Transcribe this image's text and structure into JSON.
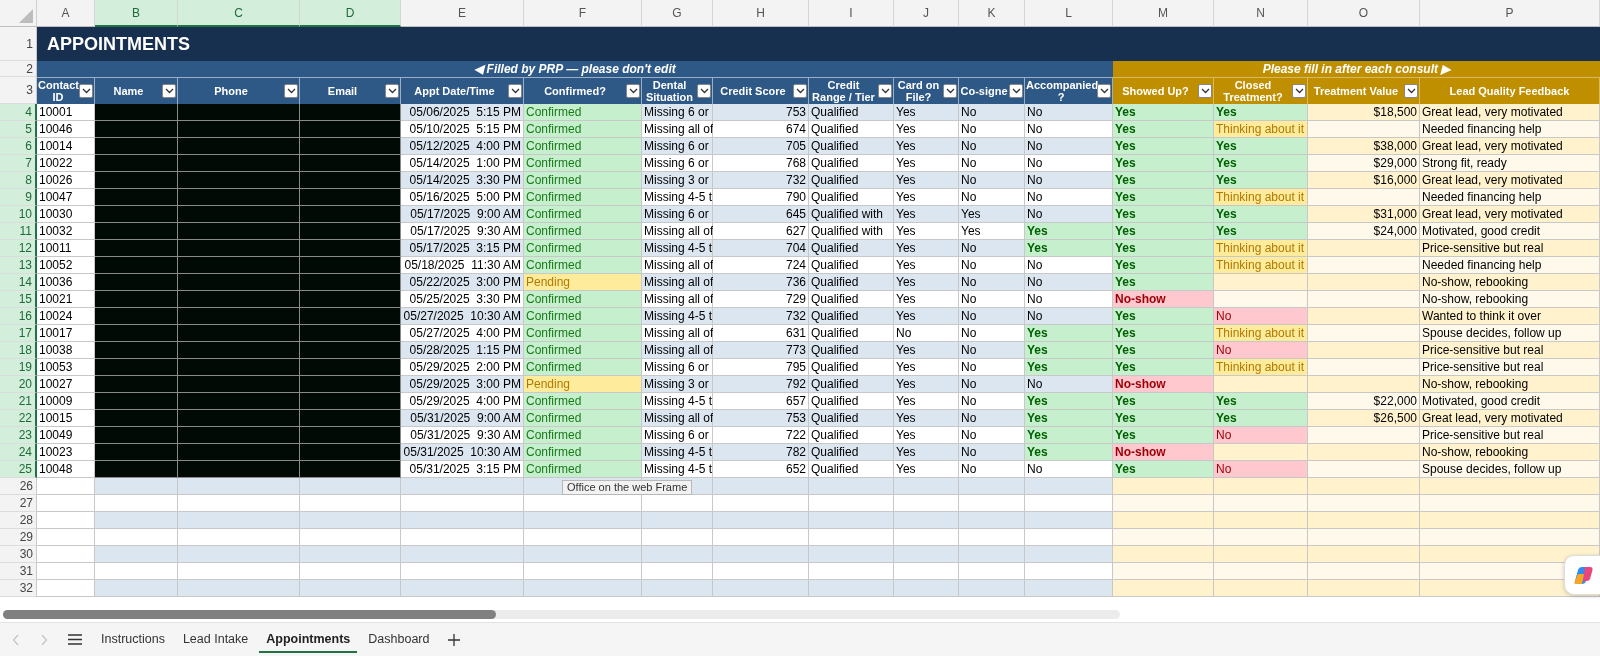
{
  "column_letters": [
    {
      "label": "A",
      "selected": false
    },
    {
      "label": "B",
      "selected": true
    },
    {
      "label": "C",
      "selected": true
    },
    {
      "label": "D",
      "selected": true
    },
    {
      "label": "E",
      "selected": false
    },
    {
      "label": "F",
      "selected": false
    },
    {
      "label": "G",
      "selected": false
    },
    {
      "label": "H",
      "selected": false
    },
    {
      "label": "I",
      "selected": false
    },
    {
      "label": "J",
      "selected": false
    },
    {
      "label": "K",
      "selected": false
    },
    {
      "label": "L",
      "selected": false
    },
    {
      "label": "M",
      "selected": false
    },
    {
      "label": "N",
      "selected": false
    },
    {
      "label": "O",
      "selected": false
    },
    {
      "label": "P",
      "selected": false
    }
  ],
  "row_numbers": [
    {
      "label": "1",
      "selected": false
    },
    {
      "label": "2",
      "selected": false
    },
    {
      "label": "3",
      "selected": false
    },
    {
      "label": "4",
      "selected": true
    },
    {
      "label": "5",
      "selected": true
    },
    {
      "label": "6",
      "selected": true
    },
    {
      "label": "7",
      "selected": true
    },
    {
      "label": "8",
      "selected": true
    },
    {
      "label": "9",
      "selected": true
    },
    {
      "label": "10",
      "selected": true
    },
    {
      "label": "11",
      "selected": true
    },
    {
      "label": "12",
      "selected": true
    },
    {
      "label": "13",
      "selected": true
    },
    {
      "label": "14",
      "selected": true
    },
    {
      "label": "15",
      "selected": true
    },
    {
      "label": "16",
      "selected": true
    },
    {
      "label": "17",
      "selected": true
    },
    {
      "label": "18",
      "selected": true
    },
    {
      "label": "19",
      "selected": true
    },
    {
      "label": "20",
      "selected": true
    },
    {
      "label": "21",
      "selected": true
    },
    {
      "label": "22",
      "selected": true
    },
    {
      "label": "23",
      "selected": true
    },
    {
      "label": "24",
      "selected": true
    },
    {
      "label": "25",
      "selected": true
    },
    {
      "label": "26",
      "selected": false
    },
    {
      "label": "27",
      "selected": false
    },
    {
      "label": "28",
      "selected": false
    },
    {
      "label": "29",
      "selected": false
    },
    {
      "label": "30",
      "selected": false
    },
    {
      "label": "31",
      "selected": false
    },
    {
      "label": "32",
      "selected": false
    }
  ],
  "title": "APPOINTMENTS",
  "banner_left": "◀ Filled by PRP — please don't edit",
  "banner_right": "Please fill in after each consult ▶",
  "contact_details_redacted": true,
  "columns": [
    {
      "label": "Contact ID",
      "filter": true
    },
    {
      "label": "Name",
      "filter": true
    },
    {
      "label": "Phone",
      "filter": true
    },
    {
      "label": "Email",
      "filter": true
    },
    {
      "label": "Appt Date/Time",
      "filter": true
    },
    {
      "label": "Confirmed?",
      "filter": true
    },
    {
      "label": "Dental Situation",
      "filter": true
    },
    {
      "label": "Credit Score",
      "filter": true
    },
    {
      "label": "Credit Range / Tier",
      "filter": true
    },
    {
      "label": "Card on File?",
      "filter": true
    },
    {
      "label": "Co-signe",
      "filter": true
    },
    {
      "label": "Accompanied ?",
      "filter": true
    },
    {
      "label": "Showed Up?",
      "filter": true
    },
    {
      "label": "Closed Treatment?",
      "filter": true
    },
    {
      "label": "Treatment Value",
      "filter": true
    },
    {
      "label": "Lead Quality Feedback",
      "filter": false
    }
  ],
  "rows": [
    {
      "id": "10001",
      "date_time": "05/06/2025  5:15 PM",
      "confirmed": {
        "text": "Confirmed",
        "kind": "confirmed"
      },
      "dental": "Missing 6 or",
      "score": "753",
      "range": "Qualified",
      "card": "Yes",
      "cosigner": "No",
      "accompanied": "No",
      "accompanied_flag": false,
      "showed": {
        "text": "Yes",
        "kind": "yes"
      },
      "closed": {
        "text": "Yes",
        "kind": "yes"
      },
      "value": "$18,500",
      "feedback": "Great lead, very motivated"
    },
    {
      "id": "10046",
      "date_time": "05/10/2025  5:15 PM",
      "confirmed": {
        "text": "Confirmed",
        "kind": "confirmed"
      },
      "dental": "Missing all of",
      "score": "674",
      "range": "Qualified",
      "card": "Yes",
      "cosigner": "No",
      "accompanied": "No",
      "accompanied_flag": false,
      "showed": {
        "text": "Yes",
        "kind": "yes"
      },
      "closed": {
        "text": "Thinking about it",
        "kind": "thinking"
      },
      "feedback": "Needed financing help"
    },
    {
      "id": "10014",
      "date_time": "05/12/2025  4:00 PM",
      "confirmed": {
        "text": "Confirmed",
        "kind": "confirmed"
      },
      "dental": "Missing 6 or",
      "score": "705",
      "range": "Qualified",
      "card": "Yes",
      "cosigner": "No",
      "accompanied": "No",
      "accompanied_flag": false,
      "showed": {
        "text": "Yes",
        "kind": "yes"
      },
      "closed": {
        "text": "Yes",
        "kind": "yes"
      },
      "value": "$38,000",
      "feedback": "Great lead, very motivated"
    },
    {
      "id": "10022",
      "date_time": "05/14/2025  1:00 PM",
      "confirmed": {
        "text": "Confirmed",
        "kind": "confirmed"
      },
      "dental": "Missing 6 or",
      "score": "768",
      "range": "Qualified",
      "card": "Yes",
      "cosigner": "No",
      "accompanied": "No",
      "accompanied_flag": false,
      "showed": {
        "text": "Yes",
        "kind": "yes"
      },
      "closed": {
        "text": "Yes",
        "kind": "yes"
      },
      "value": "$29,000",
      "feedback": "Strong fit, ready"
    },
    {
      "id": "10026",
      "date_time": "05/14/2025  3:30 PM",
      "confirmed": {
        "text": "Confirmed",
        "kind": "confirmed"
      },
      "dental": "Missing 3 or",
      "score": "732",
      "range": "Qualified",
      "card": "Yes",
      "cosigner": "No",
      "accompanied": "No",
      "accompanied_flag": false,
      "showed": {
        "text": "Yes",
        "kind": "yes"
      },
      "closed": {
        "text": "Yes",
        "kind": "yes"
      },
      "value": "$16,000",
      "feedback": "Great lead, very motivated"
    },
    {
      "id": "10047",
      "date_time": "05/16/2025  5:00 PM",
      "confirmed": {
        "text": "Confirmed",
        "kind": "confirmed"
      },
      "dental": "Missing 4-5 t",
      "score": "790",
      "range": "Qualified",
      "card": "Yes",
      "cosigner": "No",
      "accompanied": "No",
      "accompanied_flag": false,
      "showed": {
        "text": "Yes",
        "kind": "yes"
      },
      "closed": {
        "text": "Thinking about it",
        "kind": "thinking"
      },
      "feedback": "Needed financing help"
    },
    {
      "id": "10030",
      "date_time": "05/17/2025  9:00 AM",
      "confirmed": {
        "text": "Confirmed",
        "kind": "confirmed"
      },
      "dental": "Missing 6 or",
      "score": "645",
      "range": "Qualified with",
      "card": "Yes",
      "cosigner": "Yes",
      "accompanied": "No",
      "accompanied_flag": false,
      "showed": {
        "text": "Yes",
        "kind": "yes"
      },
      "closed": {
        "text": "Yes",
        "kind": "yes"
      },
      "value": "$31,000",
      "feedback": "Great lead, very motivated"
    },
    {
      "id": "10032",
      "date_time": "05/17/2025  9:30 AM",
      "confirmed": {
        "text": "Confirmed",
        "kind": "confirmed"
      },
      "dental": "Missing all of",
      "score": "627",
      "range": "Qualified with",
      "card": "Yes",
      "cosigner": "Yes",
      "accompanied": "Yes",
      "accompanied_flag": true,
      "showed": {
        "text": "Yes",
        "kind": "yes"
      },
      "closed": {
        "text": "Yes",
        "kind": "yes"
      },
      "value": "$24,000",
      "feedback": "Motivated, good credit"
    },
    {
      "id": "10011",
      "date_time": "05/17/2025  3:15 PM",
      "confirmed": {
        "text": "Confirmed",
        "kind": "confirmed"
      },
      "dental": "Missing 4-5 t",
      "score": "704",
      "range": "Qualified",
      "card": "Yes",
      "cosigner": "No",
      "accompanied": "Yes",
      "accompanied_flag": true,
      "showed": {
        "text": "Yes",
        "kind": "yes"
      },
      "closed": {
        "text": "Thinking about it",
        "kind": "thinking"
      },
      "feedback": "Price-sensitive but real"
    },
    {
      "id": "10052",
      "date_time": "05/18/2025  11:30 AM",
      "confirmed": {
        "text": "Confirmed",
        "kind": "confirmed"
      },
      "dental": "Missing all of",
      "score": "724",
      "range": "Qualified",
      "card": "Yes",
      "cosigner": "No",
      "accompanied": "No",
      "accompanied_flag": false,
      "showed": {
        "text": "Yes",
        "kind": "yes"
      },
      "closed": {
        "text": "Thinking about it",
        "kind": "thinking"
      },
      "feedback": "Needed financing help"
    },
    {
      "id": "10036",
      "date_time": "05/22/2025  3:00 PM",
      "confirmed": {
        "text": "Pending",
        "kind": "pending"
      },
      "dental": "Missing all of",
      "score": "736",
      "range": "Qualified",
      "card": "Yes",
      "cosigner": "No",
      "accompanied": "No",
      "accompanied_flag": false,
      "showed": {
        "text": "Yes",
        "kind": "yes"
      },
      "feedback": "No-show, rebooking"
    },
    {
      "id": "10021",
      "date_time": "05/25/2025  3:30 PM",
      "confirmed": {
        "text": "Confirmed",
        "kind": "confirmed"
      },
      "dental": "Missing all of",
      "score": "729",
      "range": "Qualified",
      "card": "Yes",
      "cosigner": "No",
      "accompanied": "No",
      "accompanied_flag": false,
      "showed": {
        "text": "No-show",
        "kind": "no_show"
      },
      "feedback": "No-show, rebooking"
    },
    {
      "id": "10024",
      "date_time": "05/27/2025  10:30 AM",
      "confirmed": {
        "text": "Confirmed",
        "kind": "confirmed"
      },
      "dental": "Missing 4-5 t",
      "score": "732",
      "range": "Qualified",
      "card": "Yes",
      "cosigner": "No",
      "accompanied": "No",
      "accompanied_flag": false,
      "showed": {
        "text": "Yes",
        "kind": "yes"
      },
      "closed": {
        "text": "No",
        "kind": "no"
      },
      "feedback": "Wanted to think it over"
    },
    {
      "id": "10017",
      "date_time": "05/27/2025  4:00 PM",
      "confirmed": {
        "text": "Confirmed",
        "kind": "confirmed"
      },
      "dental": "Missing all of",
      "score": "631",
      "range": "Qualified",
      "card": "No",
      "cosigner": "No",
      "accompanied": "Yes",
      "accompanied_flag": true,
      "showed": {
        "text": "Yes",
        "kind": "yes"
      },
      "closed": {
        "text": "Thinking about it",
        "kind": "thinking"
      },
      "feedback": "Spouse decides, follow up"
    },
    {
      "id": "10038",
      "date_time": "05/28/2025  1:15 PM",
      "confirmed": {
        "text": "Confirmed",
        "kind": "confirmed"
      },
      "dental": "Missing all of",
      "score": "773",
      "range": "Qualified",
      "card": "Yes",
      "cosigner": "No",
      "accompanied": "Yes",
      "accompanied_flag": true,
      "showed": {
        "text": "Yes",
        "kind": "yes"
      },
      "closed": {
        "text": "No",
        "kind": "no"
      },
      "feedback": "Price-sensitive but real"
    },
    {
      "id": "10053",
      "date_time": "05/29/2025  2:00 PM",
      "confirmed": {
        "text": "Confirmed",
        "kind": "confirmed"
      },
      "dental": "Missing 6 or",
      "score": "795",
      "range": "Qualified",
      "card": "Yes",
      "cosigner": "No",
      "accompanied": "Yes",
      "accompanied_flag": true,
      "showed": {
        "text": "Yes",
        "kind": "yes"
      },
      "closed": {
        "text": "Thinking about it",
        "kind": "thinking"
      },
      "feedback": "Price-sensitive but real"
    },
    {
      "id": "10027",
      "date_time": "05/29/2025  3:00 PM",
      "confirmed": {
        "text": "Pending",
        "kind": "pending"
      },
      "dental": "Missing 3 or",
      "score": "792",
      "range": "Qualified",
      "card": "Yes",
      "cosigner": "No",
      "accompanied": "No",
      "accompanied_flag": false,
      "showed": {
        "text": "No-show",
        "kind": "no_show"
      },
      "feedback": "No-show, rebooking"
    },
    {
      "id": "10009",
      "date_time": "05/29/2025  4:00 PM",
      "confirmed": {
        "text": "Confirmed",
        "kind": "confirmed"
      },
      "dental": "Missing 4-5 t",
      "score": "657",
      "range": "Qualified",
      "card": "Yes",
      "cosigner": "No",
      "accompanied": "Yes",
      "accompanied_flag": true,
      "showed": {
        "text": "Yes",
        "kind": "yes"
      },
      "closed": {
        "text": "Yes",
        "kind": "yes"
      },
      "value": "$22,000",
      "feedback": "Motivated, good credit"
    },
    {
      "id": "10015",
      "date_time": "05/31/2025  9:00 AM",
      "confirmed": {
        "text": "Confirmed",
        "kind": "confirmed"
      },
      "dental": "Missing all of",
      "score": "753",
      "range": "Qualified",
      "card": "Yes",
      "cosigner": "No",
      "accompanied": "Yes",
      "accompanied_flag": true,
      "showed": {
        "text": "Yes",
        "kind": "yes"
      },
      "closed": {
        "text": "Yes",
        "kind": "yes"
      },
      "value": "$26,500",
      "feedback": "Great lead, very motivated"
    },
    {
      "id": "10049",
      "date_time": "05/31/2025  9:30 AM",
      "confirmed": {
        "text": "Confirmed",
        "kind": "confirmed"
      },
      "dental": "Missing 6 or",
      "score": "722",
      "range": "Qualified",
      "card": "Yes",
      "cosigner": "No",
      "accompanied": "Yes",
      "accompanied_flag": true,
      "showed": {
        "text": "Yes",
        "kind": "yes"
      },
      "closed": {
        "text": "No",
        "kind": "no"
      },
      "feedback": "Price-sensitive but real"
    },
    {
      "id": "10023",
      "date_time": "05/31/2025  10:30 AM",
      "confirmed": {
        "text": "Confirmed",
        "kind": "confirmed"
      },
      "dental": "Missing 4-5 t",
      "score": "782",
      "range": "Qualified",
      "card": "Yes",
      "cosigner": "No",
      "accompanied": "Yes",
      "accompanied_flag": true,
      "showed": {
        "text": "No-show",
        "kind": "no_show"
      },
      "feedback": "No-show, rebooking"
    },
    {
      "id": "10048",
      "date_time": "05/31/2025  3:15 PM",
      "confirmed": {
        "text": "Confirmed",
        "kind": "confirmed"
      },
      "dental": "Missing 4-5 t",
      "score": "652",
      "range": "Qualified",
      "card": "Yes",
      "cosigner": "No",
      "accompanied": "No",
      "accompanied_flag": false,
      "showed": {
        "text": "Yes",
        "kind": "yes"
      },
      "closed": {
        "text": "No",
        "kind": "no"
      },
      "feedback": "Spouse decides, follow up"
    }
  ],
  "tooltip": "Office on the web Frame",
  "sheet_tabs": [
    {
      "label": "Instructions",
      "selected": false
    },
    {
      "label": "Lead Intake",
      "selected": false
    },
    {
      "label": "Appointments",
      "selected": true
    },
    {
      "label": "Dashboard",
      "selected": false
    }
  ]
}
